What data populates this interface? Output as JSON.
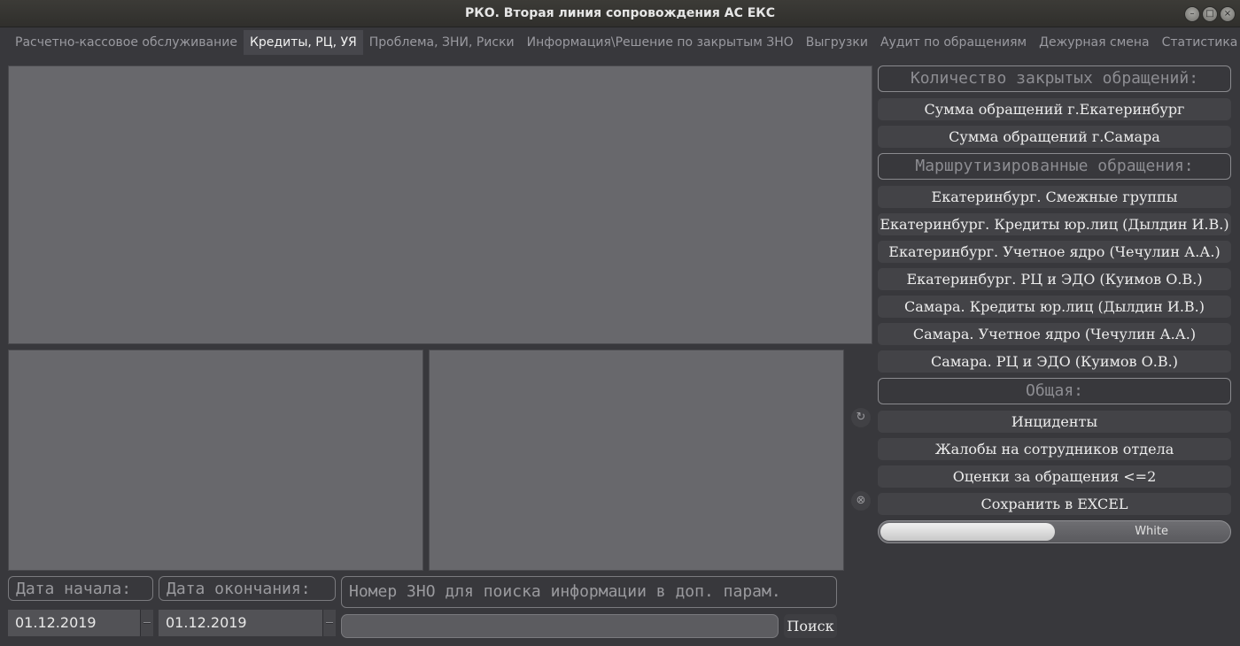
{
  "window": {
    "title": "РКО. Вторая линия сопровождения АС ЕКС",
    "controls": {
      "minimize": "–",
      "maximize": "□",
      "close": "×"
    }
  },
  "tabs": [
    {
      "label": "Расчетно-кассовое обслуживание",
      "active": false
    },
    {
      "label": "Кредиты, РЦ, УЯ",
      "active": true
    },
    {
      "label": "Проблема, ЗНИ, Риски",
      "active": false
    },
    {
      "label": "Информация\\Решение по закрытым ЗНО",
      "active": false
    },
    {
      "label": "Выгрузки",
      "active": false
    },
    {
      "label": "Аудит по обращениям",
      "active": false
    },
    {
      "label": "Дежурная смена",
      "active": false
    },
    {
      "label": "Статистика",
      "active": false
    }
  ],
  "side_buttons": {
    "refresh_icon": "↻",
    "clear_icon": "⊗"
  },
  "right_panel": {
    "closed_header": "Количество закрытых обращений:",
    "sum_ekb": "Сумма обращений г.Екатеринбург",
    "sum_samara": "Сумма обращений г.Самара",
    "routed_header": "Маршрутизированные обращения:",
    "routed": [
      "Екатеринбург. Смежные группы",
      "Екатеринбург. Кредиты юр.лиц (Дылдин И.В.)",
      "Екатеринбург. Учетное ядро (Чечулин А.А.)",
      "Екатеринбург. РЦ и ЭДО (Куимов О.В.)",
      "Самара. Кредиты юр.лиц (Дылдин И.В.)",
      "Самара. Учетное ядро (Чечулин А.А.)",
      "Самара. РЦ и ЭДО (Куимов О.В.)"
    ],
    "general_header": "Общая:",
    "general": [
      "Инциденты",
      "Жалобы на сотрудников отдела",
      "Оценки за обращения <=2",
      "Сохранить в EXCEL"
    ],
    "theme_toggle": {
      "label": "White",
      "level": 0.5
    }
  },
  "bottom": {
    "start_label": "Дата начала:",
    "end_label": "Дата окончания:",
    "search_label": "Номер ЗНО для поиска информации в доп. парам.",
    "start_date": "01.12.2019",
    "end_date": "01.12.2019",
    "search_value": "",
    "search_button": "Поиск"
  },
  "colors": {
    "background": "#38383c",
    "panel": "#68686c",
    "button": "#434347",
    "active_tab": "#47474c"
  }
}
